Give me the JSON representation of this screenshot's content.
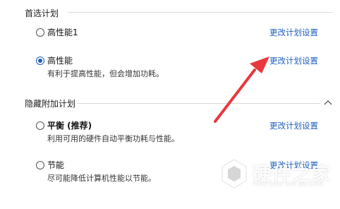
{
  "preferred_section": {
    "title": "首选计划",
    "plans": [
      {
        "name": "高性能1",
        "description": "",
        "selected": false,
        "link": "更改计划设置"
      },
      {
        "name": "高性能",
        "description": "有利于提高性能，但会增加功耗。",
        "selected": true,
        "link": "更改计划设置"
      }
    ]
  },
  "hidden_section": {
    "title": "隐藏附加计划",
    "expanded": true,
    "plans": [
      {
        "name": "平衡 (推荐)",
        "description": "利用可用的硬件自动平衡功耗与性能。",
        "selected": false,
        "link": "更改计划设置"
      },
      {
        "name": "节能",
        "description": "尽可能降低计算机性能以节能。",
        "selected": false,
        "link": "更改计划设置"
      }
    ]
  },
  "annotation": {
    "arrow_color": "#e8383d"
  },
  "watermark": {
    "title": "硬件之家",
    "subtitle": "YING JIAN ZHI JIA.COM"
  },
  "colors": {
    "accent": "#1f5fbf",
    "divider": "#d9d9d9"
  }
}
